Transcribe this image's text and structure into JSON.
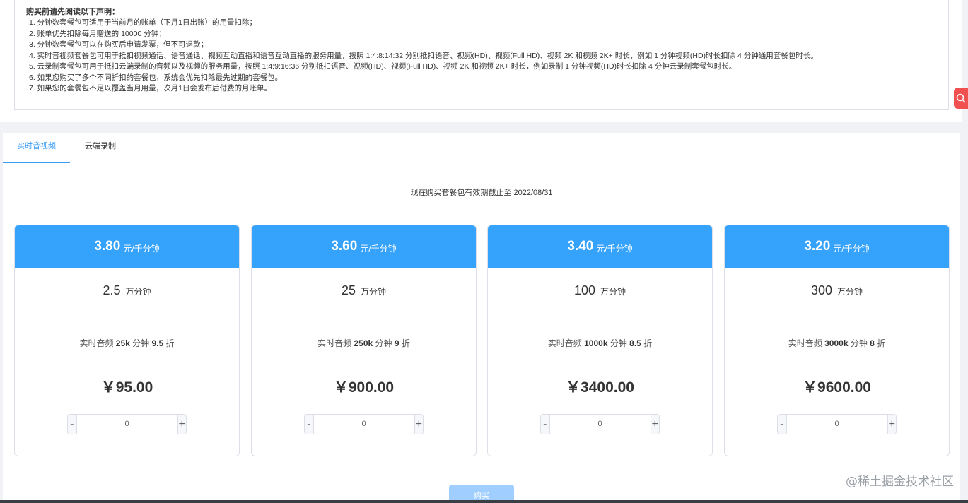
{
  "notice": {
    "title": "购买前请先阅读以下声明：",
    "lines": [
      "1. 分钟数套餐包可适用于当前月的账单（下月1日出账）的用量扣除；",
      "2. 账单优先扣除每月赠送的 10000 分钟；",
      "3. 分钟数套餐包可以在购买后申请发票，但不可退款；",
      "4. 实时音视频套餐包可用于抵扣视频通话、语音通话、视频互动直播和语音互动直播的服务用量，按照 1:4:8:14:32 分别抵扣语音、视频(HD)、视频(Full HD)、视频 2K 和视频 2K+ 时长，例如 1 分钟视频(HD)时长扣除 4 分钟通用套餐包时长。",
      "5. 云录制套餐包可用于抵扣云端录制的音频以及视频的服务用量，按照 1:4:9:16:36 分别抵扣语音、视频(HD)、视频(Full HD)、视频 2K 和视频 2K+ 时长，例如录制 1 分钟视频(HD)时长扣除 4 分钟云录制套餐包时长。",
      "6. 如果您购买了多个不同折扣的套餐包，系统会优先扣除最先过期的套餐包。",
      "7. 如果您的套餐包不足以覆盖当月用量，次月1日会发布后付费的月账单。"
    ]
  },
  "tabs": [
    {
      "label": "实时音视频",
      "active": true
    },
    {
      "label": "云端录制",
      "active": false
    }
  ],
  "validity_text": "现在购买套餐包有效期截止至 2022/08/31",
  "price_unit": "元/千分钟",
  "amount_unit": "万分钟",
  "cards": [
    {
      "price": "3.80",
      "amount": "2.5",
      "desc_prefix": "实时音频 ",
      "desc_bold": "25k",
      "desc_mid": " 分钟 ",
      "desc_discount": "9.5",
      "desc_suffix": " 折",
      "total": "￥95.00",
      "qty": "0"
    },
    {
      "price": "3.60",
      "amount": "25",
      "desc_prefix": "实时音频 ",
      "desc_bold": "250k",
      "desc_mid": " 分钟 ",
      "desc_discount": "9",
      "desc_suffix": " 折",
      "total": "￥900.00",
      "qty": "0"
    },
    {
      "price": "3.40",
      "amount": "100",
      "desc_prefix": "实时音频 ",
      "desc_bold": "1000k",
      "desc_mid": " 分钟 ",
      "desc_discount": "8.5",
      "desc_suffix": " 折",
      "total": "￥3400.00",
      "qty": "0"
    },
    {
      "price": "3.20",
      "amount": "300",
      "desc_prefix": "实时音频 ",
      "desc_bold": "3000k",
      "desc_mid": " 分钟 ",
      "desc_discount": "8",
      "desc_suffix": " 折",
      "total": "￥9600.00",
      "qty": "0"
    }
  ],
  "stepper": {
    "minus": "-",
    "plus": "+"
  },
  "buy_label": "购买",
  "watermark": "@稀土掘金技术社区",
  "colors": {
    "accent": "#35a2fb",
    "tab_active": "#3a9cf5",
    "buy_disabled": "#a0cfff",
    "search_tab": "#f05050"
  }
}
